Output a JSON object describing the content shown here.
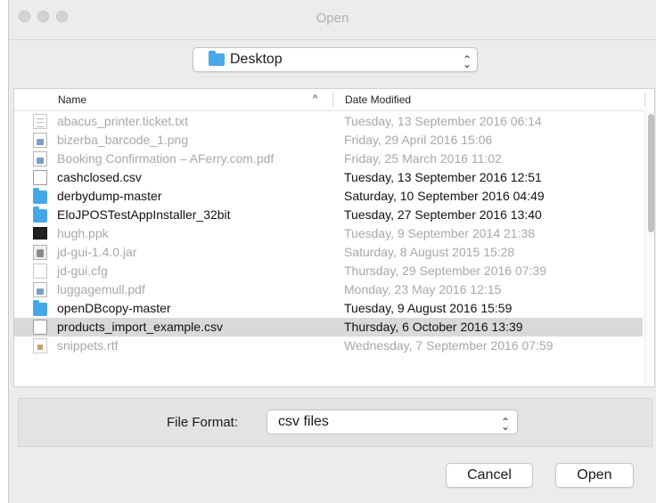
{
  "window": {
    "title": "Open"
  },
  "location": {
    "selected": "Desktop",
    "folder_icon": "folder-icon",
    "arrows_icon": "up-down-arrows-icon"
  },
  "file_list": {
    "columns": {
      "name": "Name",
      "date_modified": "Date Modified",
      "sort": "ascending"
    },
    "rows": [
      {
        "name": "abacus_printer.ticket.txt",
        "date": "Tuesday, 13 September 2016 06:14",
        "icon": "text-document-icon",
        "enabled": false,
        "selected": false
      },
      {
        "name": "bizerba_barcode_1.png",
        "date": "Friday, 29 April 2016 15:06",
        "icon": "image-file-icon",
        "enabled": false,
        "selected": false
      },
      {
        "name": "Booking Confirmation – AFerry.com.pdf",
        "date": "Friday, 25 March 2016 11:02",
        "icon": "pdf-file-icon",
        "enabled": false,
        "selected": false
      },
      {
        "name": "cashclosed.csv",
        "date": "Tuesday, 13 September 2016 12:51",
        "icon": "document-icon",
        "enabled": true,
        "selected": false
      },
      {
        "name": "derbydump-master",
        "date": "Saturday, 10 September 2016 04:49",
        "icon": "folder-icon",
        "enabled": true,
        "selected": false
      },
      {
        "name": "EloJPOSTestAppInstaller_32bit",
        "date": "Tuesday, 27 September 2016 13:40",
        "icon": "folder-icon",
        "enabled": true,
        "selected": false
      },
      {
        "name": "hugh.ppk",
        "date": "Tuesday, 9 September 2014 21:38",
        "icon": "terminal-file-icon",
        "enabled": false,
        "selected": false
      },
      {
        "name": "jd-gui-1.4.0.jar",
        "date": "Saturday, 8 August 2015 15:28",
        "icon": "jar-file-icon",
        "enabled": false,
        "selected": false
      },
      {
        "name": "jd-gui.cfg",
        "date": "Thursday, 29 September 2016 07:39",
        "icon": "document-icon",
        "enabled": false,
        "selected": false
      },
      {
        "name": "luggagemull.pdf",
        "date": "Monday, 23 May 2016 12:15",
        "icon": "pdf-file-icon",
        "enabled": false,
        "selected": false
      },
      {
        "name": "openDBcopy-master",
        "date": "Tuesday, 9 August 2016 15:59",
        "icon": "folder-icon",
        "enabled": true,
        "selected": false
      },
      {
        "name": "products_import_example.csv",
        "date": "Thursday, 6 October 2016 13:39",
        "icon": "document-icon",
        "enabled": true,
        "selected": true
      },
      {
        "name": "snippets.rtf",
        "date": "Wednesday, 7 September 2016 07:59",
        "icon": "rtf-file-icon",
        "enabled": false,
        "selected": false
      }
    ]
  },
  "format": {
    "label": "File Format:",
    "selected": "csv files"
  },
  "buttons": {
    "cancel": "Cancel",
    "open": "Open"
  }
}
